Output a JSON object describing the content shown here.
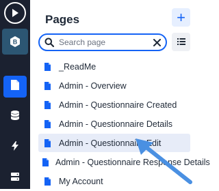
{
  "rail": {
    "items": [
      {
        "name": "play",
        "icon": "play-icon"
      },
      {
        "name": "brand",
        "icon": "bubble-logo-icon"
      },
      {
        "name": "pages",
        "icon": "document-icon"
      },
      {
        "name": "data",
        "icon": "database-icon"
      },
      {
        "name": "workflows",
        "icon": "lightning-icon"
      },
      {
        "name": "settings",
        "icon": "server-icon"
      }
    ]
  },
  "header": {
    "title": "Pages",
    "add_label": "+"
  },
  "search": {
    "placeholder": "Search page",
    "value": ""
  },
  "pages": [
    {
      "label": "_ReadMe"
    },
    {
      "label": "Admin - Overview"
    },
    {
      "label": "Admin - Questionnaire Created"
    },
    {
      "label": "Admin - Questionnaire Details"
    },
    {
      "label": "Admin - Questionnaire Edit",
      "highlighted": true
    },
    {
      "label": "Admin - Questionnaire Response Details"
    },
    {
      "label": "My Account"
    }
  ],
  "colors": {
    "accent": "#1463f5",
    "rail_bg": "#1b2130",
    "highlight_bg": "#e7ecf8",
    "arrow": "#4a90e2"
  }
}
